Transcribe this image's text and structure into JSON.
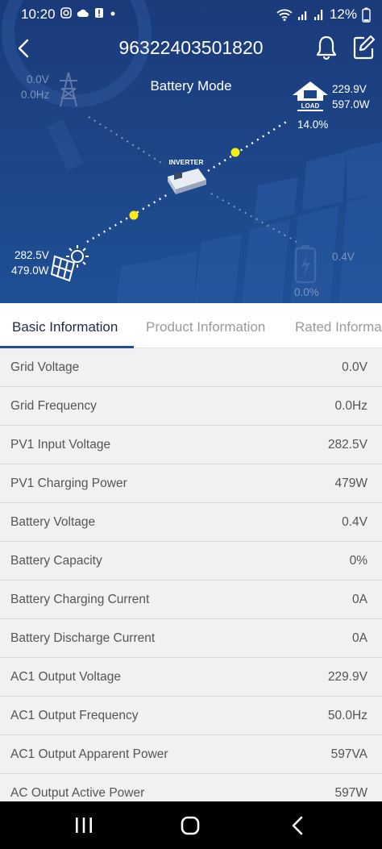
{
  "status_bar": {
    "time": "10:20",
    "battery": "12%",
    "left_icons": [
      "instagram-icon",
      "cloud-icon",
      "alert-icon",
      "dot-icon"
    ],
    "right_icons": [
      "wifi-icon",
      "signal-icon",
      "signal-icon",
      "battery-icon"
    ]
  },
  "header": {
    "title": "96322403501820"
  },
  "diagram": {
    "mode": "Battery Mode",
    "grid": {
      "voltage": "0.0V",
      "frequency": "0.0Hz"
    },
    "load": {
      "voltage": "229.9V",
      "power": "597.0W",
      "percent": "14.0%",
      "icon_label": "LOAD"
    },
    "inverter_label": "INVERTER",
    "pv": {
      "voltage": "282.5V",
      "power": "479.0W"
    },
    "battery": {
      "voltage": "0.4V",
      "percent": "0.0%"
    }
  },
  "tabs": [
    "Basic Information",
    "Product Information",
    "Rated Informa"
  ],
  "rows": [
    {
      "label": "Grid Voltage",
      "value": "0.0V"
    },
    {
      "label": "Grid Frequency",
      "value": "0.0Hz"
    },
    {
      "label": "PV1 Input Voltage",
      "value": "282.5V"
    },
    {
      "label": "PV1 Charging Power",
      "value": "479W"
    },
    {
      "label": "Battery Voltage",
      "value": "0.4V"
    },
    {
      "label": "Battery Capacity",
      "value": "0%"
    },
    {
      "label": "Battery Charging Current",
      "value": "0A"
    },
    {
      "label": "Battery Discharge Current",
      "value": "0A"
    },
    {
      "label": "AC1 Output Voltage",
      "value": "229.9V"
    },
    {
      "label": "AC1 Output Frequency",
      "value": "50.0Hz"
    },
    {
      "label": "AC1 Output Apparent Power",
      "value": "597VA"
    },
    {
      "label": "AC Output Active Power",
      "value": "597W"
    }
  ],
  "colors": {
    "hero_top": "#1b3a7a",
    "hero_bottom": "#1f4f95",
    "flow_dot": "#f5ec1a",
    "tab_accent": "#1f4f95",
    "list_bg": "#f1f1f3"
  }
}
